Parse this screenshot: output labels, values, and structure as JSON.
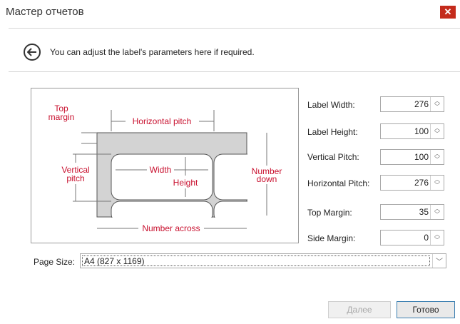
{
  "window": {
    "title": "Мастер отчетов",
    "close_glyph": "✕"
  },
  "header": {
    "instruction": "You can adjust the label's parameters here if required."
  },
  "diagram": {
    "top_margin": [
      "Top",
      "margin"
    ],
    "horizontal_pitch": "Horizontal pitch",
    "vertical_pitch": [
      "Vertical",
      "pitch"
    ],
    "width": "Width",
    "height": "Height",
    "number_down": [
      "Number",
      "down"
    ],
    "number_across": "Number across",
    "label_color": "#c8102e"
  },
  "fields": [
    {
      "label": "Label Width:",
      "value": "276"
    },
    {
      "label": "Label Height:",
      "value": "100"
    },
    {
      "label": "Vertical Pitch:",
      "value": "100"
    },
    {
      "label": "Horizontal Pitch:",
      "value": "276"
    },
    {
      "label": "Top Margin:",
      "value": "35"
    },
    {
      "label": "Side Margin:",
      "value": "0"
    }
  ],
  "page_size": {
    "label": "Page Size:",
    "value": "A4 (827 x 1169)"
  },
  "buttons": {
    "next": "Далее",
    "finish": "Готово"
  }
}
